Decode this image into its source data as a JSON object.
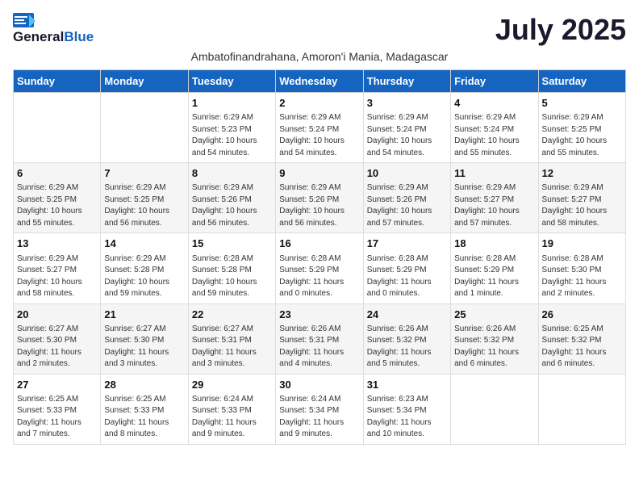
{
  "logo": {
    "general": "General",
    "blue": "Blue"
  },
  "title": "July 2025",
  "subtitle": "Ambatofinandrahana, Amoron'i Mania, Madagascar",
  "days_of_week": [
    "Sunday",
    "Monday",
    "Tuesday",
    "Wednesday",
    "Thursday",
    "Friday",
    "Saturday"
  ],
  "weeks": [
    [
      {
        "day": "",
        "info": ""
      },
      {
        "day": "",
        "info": ""
      },
      {
        "day": "1",
        "info": "Sunrise: 6:29 AM\nSunset: 5:23 PM\nDaylight: 10 hours\nand 54 minutes."
      },
      {
        "day": "2",
        "info": "Sunrise: 6:29 AM\nSunset: 5:24 PM\nDaylight: 10 hours\nand 54 minutes."
      },
      {
        "day": "3",
        "info": "Sunrise: 6:29 AM\nSunset: 5:24 PM\nDaylight: 10 hours\nand 54 minutes."
      },
      {
        "day": "4",
        "info": "Sunrise: 6:29 AM\nSunset: 5:24 PM\nDaylight: 10 hours\nand 55 minutes."
      },
      {
        "day": "5",
        "info": "Sunrise: 6:29 AM\nSunset: 5:25 PM\nDaylight: 10 hours\nand 55 minutes."
      }
    ],
    [
      {
        "day": "6",
        "info": "Sunrise: 6:29 AM\nSunset: 5:25 PM\nDaylight: 10 hours\nand 55 minutes."
      },
      {
        "day": "7",
        "info": "Sunrise: 6:29 AM\nSunset: 5:25 PM\nDaylight: 10 hours\nand 56 minutes."
      },
      {
        "day": "8",
        "info": "Sunrise: 6:29 AM\nSunset: 5:26 PM\nDaylight: 10 hours\nand 56 minutes."
      },
      {
        "day": "9",
        "info": "Sunrise: 6:29 AM\nSunset: 5:26 PM\nDaylight: 10 hours\nand 56 minutes."
      },
      {
        "day": "10",
        "info": "Sunrise: 6:29 AM\nSunset: 5:26 PM\nDaylight: 10 hours\nand 57 minutes."
      },
      {
        "day": "11",
        "info": "Sunrise: 6:29 AM\nSunset: 5:27 PM\nDaylight: 10 hours\nand 57 minutes."
      },
      {
        "day": "12",
        "info": "Sunrise: 6:29 AM\nSunset: 5:27 PM\nDaylight: 10 hours\nand 58 minutes."
      }
    ],
    [
      {
        "day": "13",
        "info": "Sunrise: 6:29 AM\nSunset: 5:27 PM\nDaylight: 10 hours\nand 58 minutes."
      },
      {
        "day": "14",
        "info": "Sunrise: 6:29 AM\nSunset: 5:28 PM\nDaylight: 10 hours\nand 59 minutes."
      },
      {
        "day": "15",
        "info": "Sunrise: 6:28 AM\nSunset: 5:28 PM\nDaylight: 10 hours\nand 59 minutes."
      },
      {
        "day": "16",
        "info": "Sunrise: 6:28 AM\nSunset: 5:29 PM\nDaylight: 11 hours\nand 0 minutes."
      },
      {
        "day": "17",
        "info": "Sunrise: 6:28 AM\nSunset: 5:29 PM\nDaylight: 11 hours\nand 0 minutes."
      },
      {
        "day": "18",
        "info": "Sunrise: 6:28 AM\nSunset: 5:29 PM\nDaylight: 11 hours\nand 1 minute."
      },
      {
        "day": "19",
        "info": "Sunrise: 6:28 AM\nSunset: 5:30 PM\nDaylight: 11 hours\nand 2 minutes."
      }
    ],
    [
      {
        "day": "20",
        "info": "Sunrise: 6:27 AM\nSunset: 5:30 PM\nDaylight: 11 hours\nand 2 minutes."
      },
      {
        "day": "21",
        "info": "Sunrise: 6:27 AM\nSunset: 5:30 PM\nDaylight: 11 hours\nand 3 minutes."
      },
      {
        "day": "22",
        "info": "Sunrise: 6:27 AM\nSunset: 5:31 PM\nDaylight: 11 hours\nand 3 minutes."
      },
      {
        "day": "23",
        "info": "Sunrise: 6:26 AM\nSunset: 5:31 PM\nDaylight: 11 hours\nand 4 minutes."
      },
      {
        "day": "24",
        "info": "Sunrise: 6:26 AM\nSunset: 5:32 PM\nDaylight: 11 hours\nand 5 minutes."
      },
      {
        "day": "25",
        "info": "Sunrise: 6:26 AM\nSunset: 5:32 PM\nDaylight: 11 hours\nand 6 minutes."
      },
      {
        "day": "26",
        "info": "Sunrise: 6:25 AM\nSunset: 5:32 PM\nDaylight: 11 hours\nand 6 minutes."
      }
    ],
    [
      {
        "day": "27",
        "info": "Sunrise: 6:25 AM\nSunset: 5:33 PM\nDaylight: 11 hours\nand 7 minutes."
      },
      {
        "day": "28",
        "info": "Sunrise: 6:25 AM\nSunset: 5:33 PM\nDaylight: 11 hours\nand 8 minutes."
      },
      {
        "day": "29",
        "info": "Sunrise: 6:24 AM\nSunset: 5:33 PM\nDaylight: 11 hours\nand 9 minutes."
      },
      {
        "day": "30",
        "info": "Sunrise: 6:24 AM\nSunset: 5:34 PM\nDaylight: 11 hours\nand 9 minutes."
      },
      {
        "day": "31",
        "info": "Sunrise: 6:23 AM\nSunset: 5:34 PM\nDaylight: 11 hours\nand 10 minutes."
      },
      {
        "day": "",
        "info": ""
      },
      {
        "day": "",
        "info": ""
      }
    ]
  ]
}
